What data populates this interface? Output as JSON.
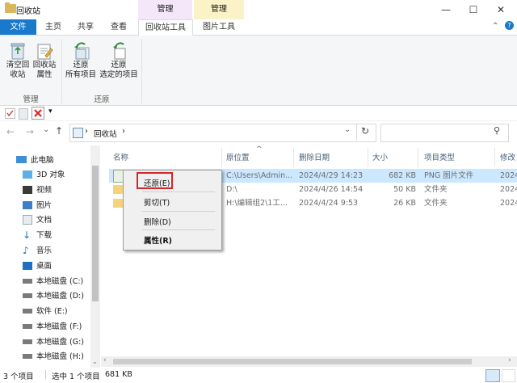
{
  "window": {
    "title": "回收站",
    "context_tab_group_1": "管理",
    "context_tab_group_2": "管理",
    "controls": {
      "minimize": "—",
      "maximize": "☐",
      "close": "✕",
      "collapse_ribbon": "⌃",
      "help": "?"
    }
  },
  "ribbon": {
    "tabs": [
      {
        "label": "文件"
      },
      {
        "label": "主页"
      },
      {
        "label": "共享"
      },
      {
        "label": "查看"
      },
      {
        "label": "回收站工具"
      },
      {
        "label": "图片工具"
      }
    ],
    "groups": [
      {
        "label": "管理",
        "buttons": [
          {
            "line1": "清空回",
            "line2": "收站"
          },
          {
            "line1": "回收站",
            "line2": "属性"
          }
        ]
      },
      {
        "label": "还原",
        "buttons": [
          {
            "line1": "还原",
            "line2": "所有项目"
          },
          {
            "line1": "还原",
            "line2": "选定的项目"
          }
        ]
      }
    ]
  },
  "quick_access": {
    "dropdown": "▾"
  },
  "address": {
    "back": "←",
    "forward": "→",
    "dropdown": "⌄",
    "up": "↑",
    "path_separator": "›",
    "path": "回收站",
    "path_end": "›",
    "history_dropdown": "⌄",
    "refresh": "↻",
    "search_icon": "⚲"
  },
  "nav": {
    "items": [
      {
        "label": "此电脑"
      },
      {
        "label": "3D 对象"
      },
      {
        "label": "视频"
      },
      {
        "label": "图片"
      },
      {
        "label": "文档"
      },
      {
        "label": "下载"
      },
      {
        "label": "音乐"
      },
      {
        "label": "桌面"
      },
      {
        "label": "本地磁盘 (C:)"
      },
      {
        "label": "本地磁盘 (D:)"
      },
      {
        "label": "软件 (E:)"
      },
      {
        "label": "本地磁盘 (F:)"
      },
      {
        "label": "本地磁盘 (G:)"
      },
      {
        "label": "本地磁盘 (H:)"
      }
    ]
  },
  "files": {
    "columns": [
      "名称",
      "原位置",
      "删除日期",
      "大小",
      "项目类型",
      "修改"
    ],
    "sort_indicator": "^",
    "rows": [
      {
        "location": "C:\\Users\\Admin...",
        "deleted": "2024/4/29 14:23",
        "size": "682 KB",
        "type": "PNG 图片文件",
        "modified": "2024"
      },
      {
        "location": "D:\\",
        "deleted": "2024/4/26 14:54",
        "size": "50 KB",
        "type": "文件夹",
        "modified": "2024"
      },
      {
        "location": "H:\\编辑组2\\1工...",
        "deleted": "2024/4/24 9:53",
        "size": "26 KB",
        "type": "文件夹",
        "modified": "2024"
      }
    ]
  },
  "context_menu": {
    "items": [
      {
        "label": "还原(E)"
      },
      {
        "label": "剪切(T)"
      },
      {
        "label": "删除(D)"
      },
      {
        "label": "属性(R)"
      }
    ]
  },
  "status": {
    "count": "3 个项目",
    "selected": "选中 1 个项目",
    "size": "681 KB"
  },
  "colors": {
    "accent": "#1979ca",
    "context_tab_1": "#f4e7fa",
    "context_tab_2": "#fbf3c7",
    "selection": "#cce8ff",
    "highlight_box": "#d6262b"
  }
}
